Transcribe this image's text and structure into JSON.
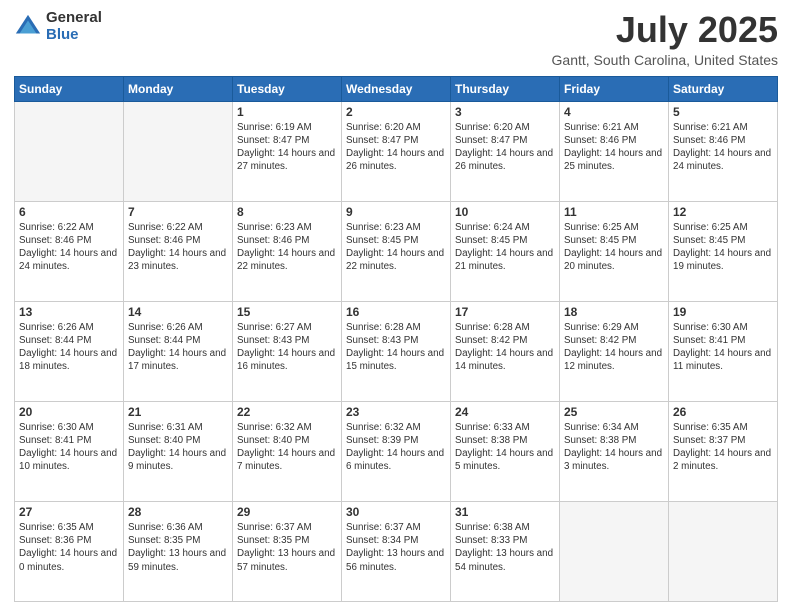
{
  "header": {
    "logo_general": "General",
    "logo_blue": "Blue",
    "main_title": "July 2025",
    "subtitle": "Gantt, South Carolina, United States"
  },
  "calendar": {
    "weekdays": [
      "Sunday",
      "Monday",
      "Tuesday",
      "Wednesday",
      "Thursday",
      "Friday",
      "Saturday"
    ],
    "weeks": [
      [
        {
          "day": null,
          "info": null
        },
        {
          "day": null,
          "info": null
        },
        {
          "day": "1",
          "info": "Sunrise: 6:19 AM\nSunset: 8:47 PM\nDaylight: 14 hours and 27 minutes."
        },
        {
          "day": "2",
          "info": "Sunrise: 6:20 AM\nSunset: 8:47 PM\nDaylight: 14 hours and 26 minutes."
        },
        {
          "day": "3",
          "info": "Sunrise: 6:20 AM\nSunset: 8:47 PM\nDaylight: 14 hours and 26 minutes."
        },
        {
          "day": "4",
          "info": "Sunrise: 6:21 AM\nSunset: 8:46 PM\nDaylight: 14 hours and 25 minutes."
        },
        {
          "day": "5",
          "info": "Sunrise: 6:21 AM\nSunset: 8:46 PM\nDaylight: 14 hours and 24 minutes."
        }
      ],
      [
        {
          "day": "6",
          "info": "Sunrise: 6:22 AM\nSunset: 8:46 PM\nDaylight: 14 hours and 24 minutes."
        },
        {
          "day": "7",
          "info": "Sunrise: 6:22 AM\nSunset: 8:46 PM\nDaylight: 14 hours and 23 minutes."
        },
        {
          "day": "8",
          "info": "Sunrise: 6:23 AM\nSunset: 8:46 PM\nDaylight: 14 hours and 22 minutes."
        },
        {
          "day": "9",
          "info": "Sunrise: 6:23 AM\nSunset: 8:45 PM\nDaylight: 14 hours and 22 minutes."
        },
        {
          "day": "10",
          "info": "Sunrise: 6:24 AM\nSunset: 8:45 PM\nDaylight: 14 hours and 21 minutes."
        },
        {
          "day": "11",
          "info": "Sunrise: 6:25 AM\nSunset: 8:45 PM\nDaylight: 14 hours and 20 minutes."
        },
        {
          "day": "12",
          "info": "Sunrise: 6:25 AM\nSunset: 8:45 PM\nDaylight: 14 hours and 19 minutes."
        }
      ],
      [
        {
          "day": "13",
          "info": "Sunrise: 6:26 AM\nSunset: 8:44 PM\nDaylight: 14 hours and 18 minutes."
        },
        {
          "day": "14",
          "info": "Sunrise: 6:26 AM\nSunset: 8:44 PM\nDaylight: 14 hours and 17 minutes."
        },
        {
          "day": "15",
          "info": "Sunrise: 6:27 AM\nSunset: 8:43 PM\nDaylight: 14 hours and 16 minutes."
        },
        {
          "day": "16",
          "info": "Sunrise: 6:28 AM\nSunset: 8:43 PM\nDaylight: 14 hours and 15 minutes."
        },
        {
          "day": "17",
          "info": "Sunrise: 6:28 AM\nSunset: 8:42 PM\nDaylight: 14 hours and 14 minutes."
        },
        {
          "day": "18",
          "info": "Sunrise: 6:29 AM\nSunset: 8:42 PM\nDaylight: 14 hours and 12 minutes."
        },
        {
          "day": "19",
          "info": "Sunrise: 6:30 AM\nSunset: 8:41 PM\nDaylight: 14 hours and 11 minutes."
        }
      ],
      [
        {
          "day": "20",
          "info": "Sunrise: 6:30 AM\nSunset: 8:41 PM\nDaylight: 14 hours and 10 minutes."
        },
        {
          "day": "21",
          "info": "Sunrise: 6:31 AM\nSunset: 8:40 PM\nDaylight: 14 hours and 9 minutes."
        },
        {
          "day": "22",
          "info": "Sunrise: 6:32 AM\nSunset: 8:40 PM\nDaylight: 14 hours and 7 minutes."
        },
        {
          "day": "23",
          "info": "Sunrise: 6:32 AM\nSunset: 8:39 PM\nDaylight: 14 hours and 6 minutes."
        },
        {
          "day": "24",
          "info": "Sunrise: 6:33 AM\nSunset: 8:38 PM\nDaylight: 14 hours and 5 minutes."
        },
        {
          "day": "25",
          "info": "Sunrise: 6:34 AM\nSunset: 8:38 PM\nDaylight: 14 hours and 3 minutes."
        },
        {
          "day": "26",
          "info": "Sunrise: 6:35 AM\nSunset: 8:37 PM\nDaylight: 14 hours and 2 minutes."
        }
      ],
      [
        {
          "day": "27",
          "info": "Sunrise: 6:35 AM\nSunset: 8:36 PM\nDaylight: 14 hours and 0 minutes."
        },
        {
          "day": "28",
          "info": "Sunrise: 6:36 AM\nSunset: 8:35 PM\nDaylight: 13 hours and 59 minutes."
        },
        {
          "day": "29",
          "info": "Sunrise: 6:37 AM\nSunset: 8:35 PM\nDaylight: 13 hours and 57 minutes."
        },
        {
          "day": "30",
          "info": "Sunrise: 6:37 AM\nSunset: 8:34 PM\nDaylight: 13 hours and 56 minutes."
        },
        {
          "day": "31",
          "info": "Sunrise: 6:38 AM\nSunset: 8:33 PM\nDaylight: 13 hours and 54 minutes."
        },
        {
          "day": null,
          "info": null
        },
        {
          "day": null,
          "info": null
        }
      ]
    ]
  }
}
